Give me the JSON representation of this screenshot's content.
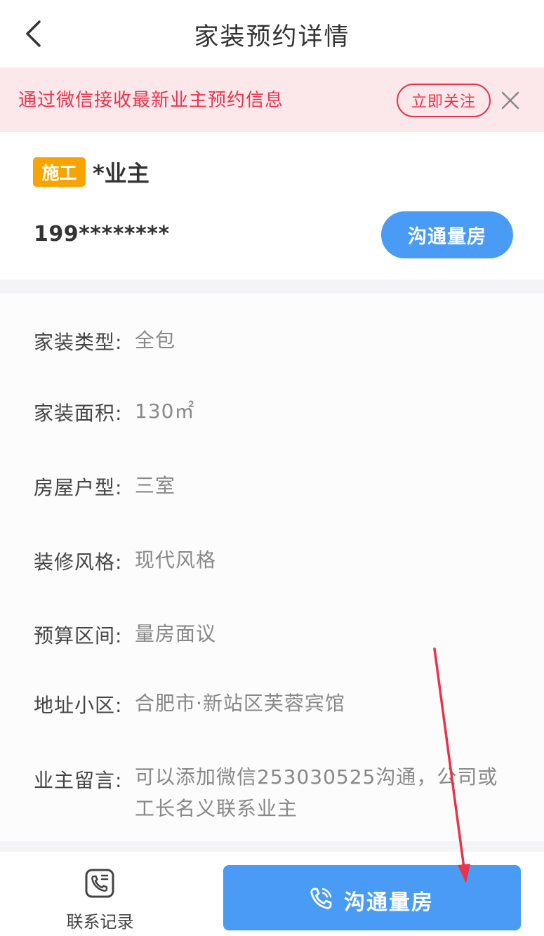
{
  "header": {
    "title": "家装预约详情",
    "back_icon": "chevron-left-icon"
  },
  "notice": {
    "text": "通过微信接收最新业主预约信息",
    "follow_label": "立即关注",
    "close_icon": "close-icon",
    "text_color": "#e8334b",
    "background": "#fce8eb"
  },
  "owner": {
    "tag": "施工",
    "tag_color": "#f7a400",
    "name": "*业主",
    "phone": "199********",
    "contact_label": "沟通量房"
  },
  "details": [
    {
      "label": "家装类型:",
      "value": "全包"
    },
    {
      "label": "家装面积:",
      "value": "130㎡"
    },
    {
      "label": "房屋户型:",
      "value": "三室"
    },
    {
      "label": "装修风格:",
      "value": "现代风格"
    },
    {
      "label": "预算区间:",
      "value": "量房面议"
    },
    {
      "label": "地址小区:",
      "value": "合肥市·新站区芙蓉宾馆"
    },
    {
      "label": "业主留言:",
      "value": "可以添加微信253030525沟通，公司或工长名义联系业主"
    }
  ],
  "bottom": {
    "records_label": "联系记录",
    "records_icon": "phone-log-icon",
    "main_label": "沟通量房",
    "main_icon": "phone-icon",
    "accent": "#4a9bf5"
  },
  "annotation": {
    "color": "#e8334b"
  }
}
